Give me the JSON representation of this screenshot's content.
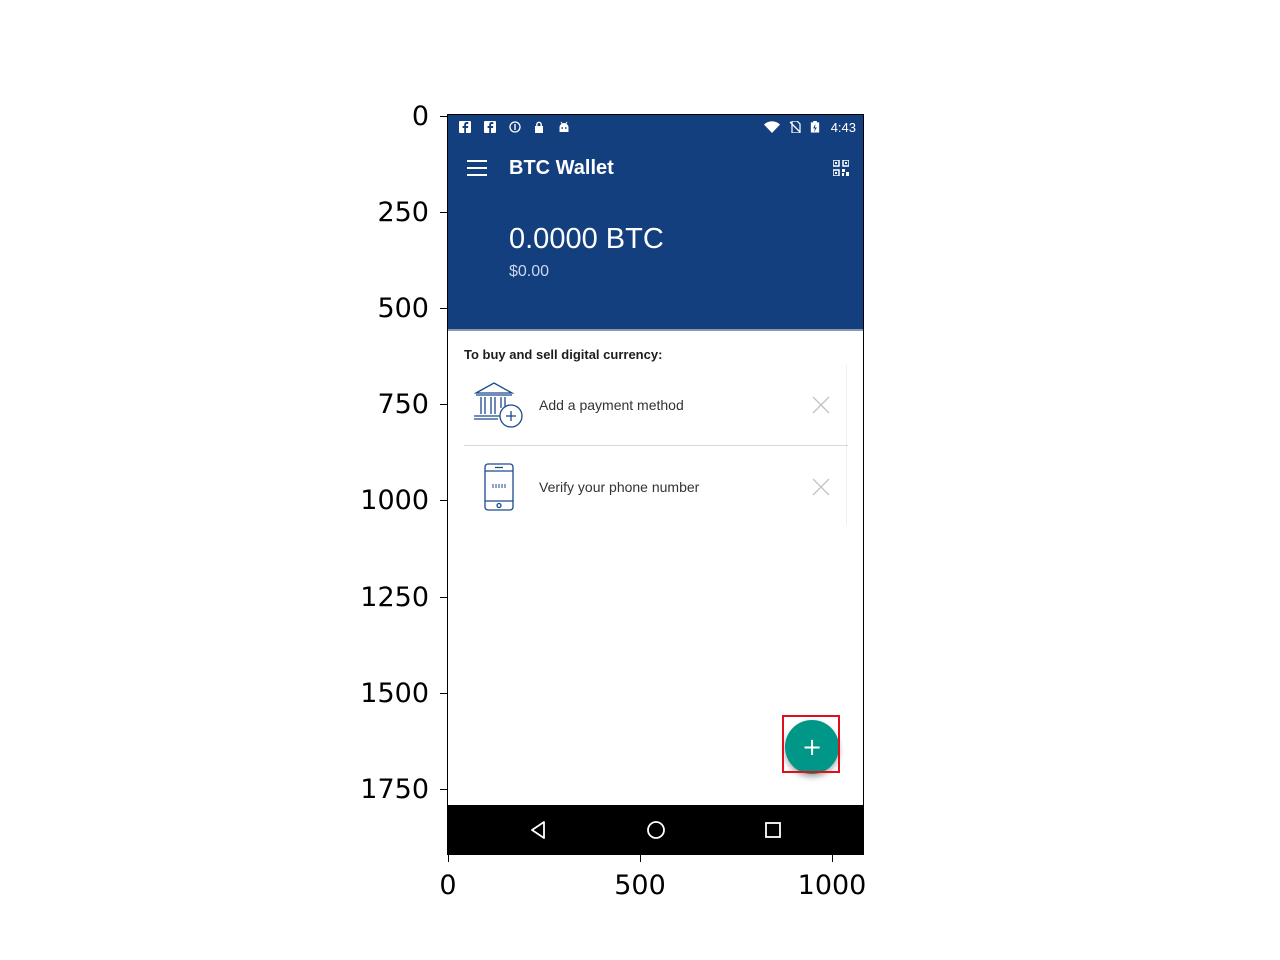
{
  "axes": {
    "y_ticks": [
      "0",
      "250",
      "500",
      "750",
      "1000",
      "1250",
      "1500",
      "1750"
    ],
    "x_ticks": [
      "0",
      "500",
      "1000"
    ]
  },
  "status_bar": {
    "time": "4:43",
    "icons_left": [
      "facebook-icon",
      "facebook-icon",
      "info-icon",
      "lock-icon",
      "android-icon"
    ],
    "icons_right": [
      "wifi-icon",
      "no-sim-icon",
      "battery-icon"
    ]
  },
  "toolbar": {
    "title": "BTC Wallet",
    "menu_icon": "menu-icon",
    "qr_icon": "qr-code-icon"
  },
  "balance": {
    "crypto": "0.0000 BTC",
    "fiat": "$0.00"
  },
  "tasks": {
    "title": "To buy and sell digital currency:",
    "items": [
      {
        "label": "Add a payment method",
        "icon": "bank-add-icon"
      },
      {
        "label": "Verify your phone number",
        "icon": "phone-icon"
      }
    ]
  },
  "fab": {
    "label": "+"
  },
  "nav": {
    "buttons": [
      "back-icon",
      "home-icon",
      "recents-icon"
    ]
  },
  "colors": {
    "primary": "#143f7e",
    "accent": "#009688",
    "highlight": "#e0101a"
  }
}
